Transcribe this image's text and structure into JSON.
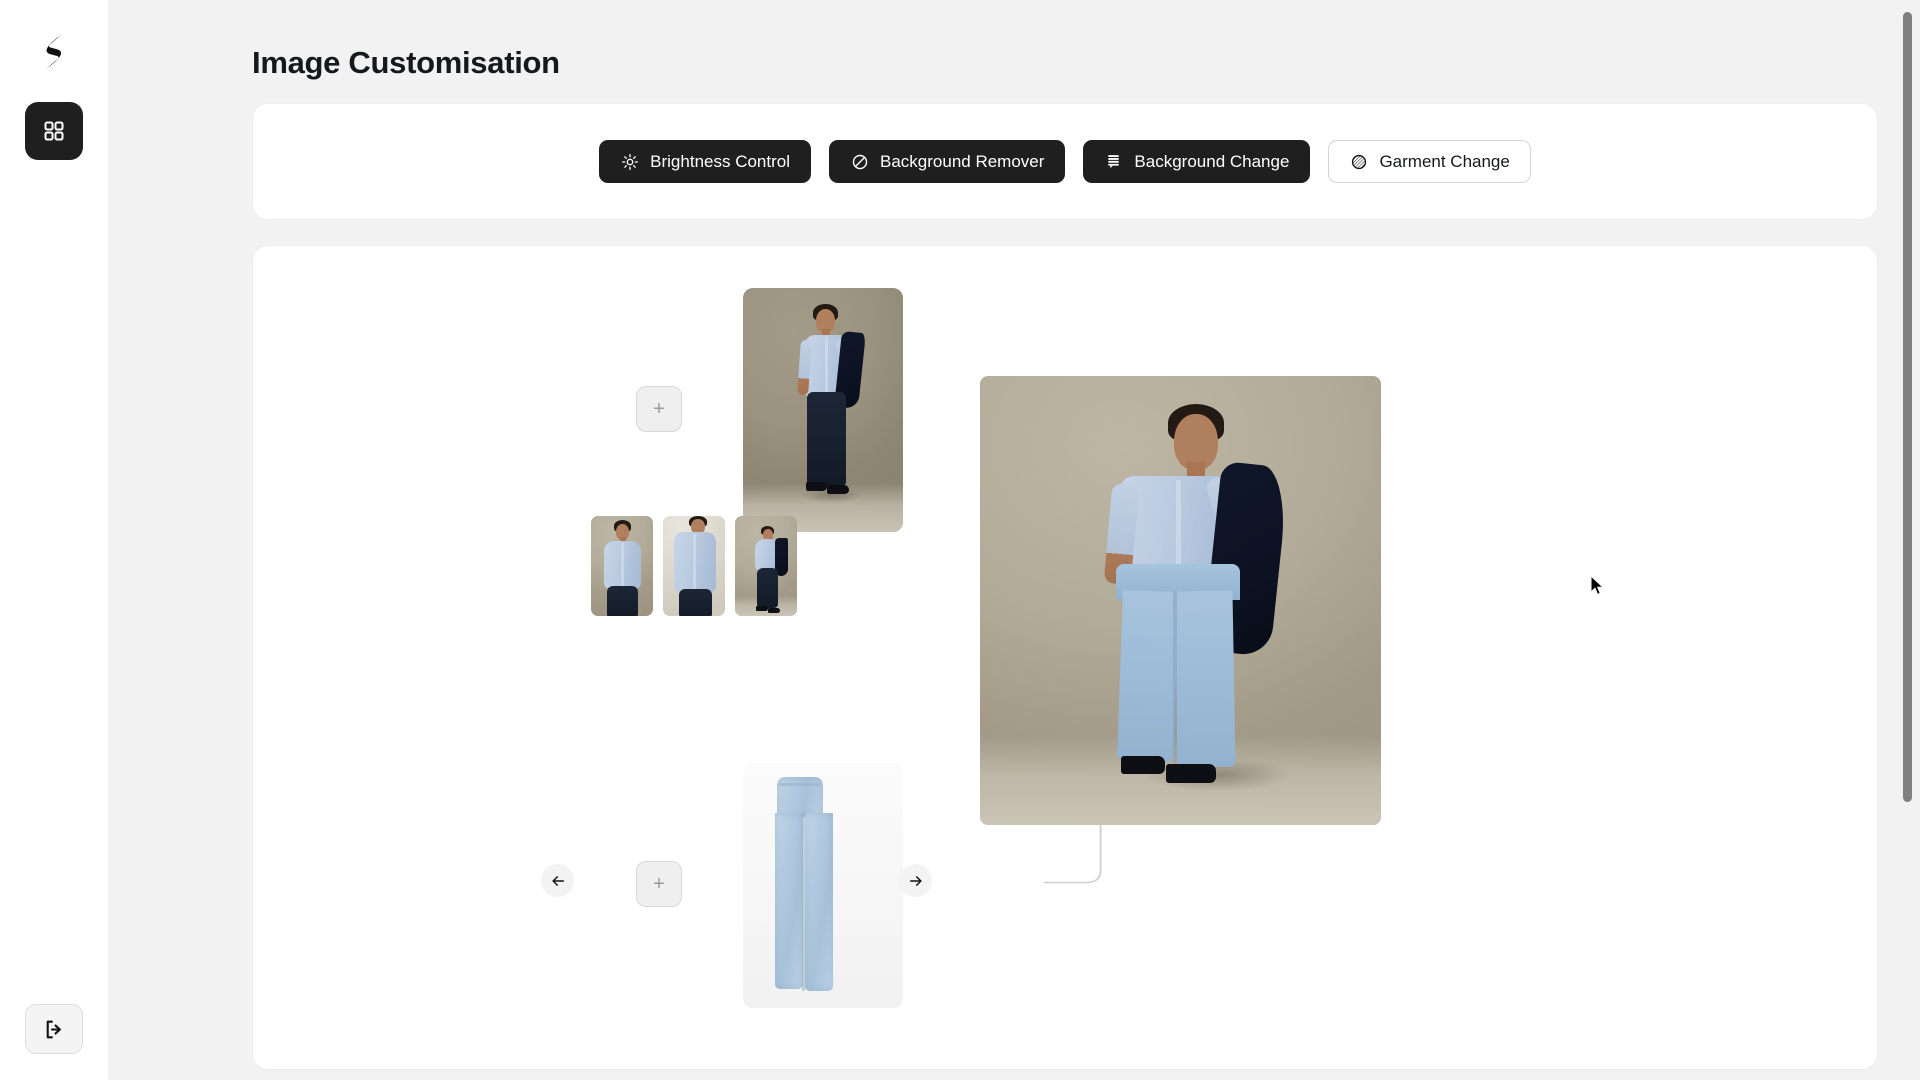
{
  "app": {
    "logo_icon": "brand-s-logo",
    "nav": [
      {
        "id": "dashboard",
        "icon": "grid-icon",
        "active": true
      }
    ],
    "logout": {
      "icon": "logout-icon",
      "label": "Logout"
    }
  },
  "header": {
    "title": "Image Customisation"
  },
  "toolbar": {
    "buttons": [
      {
        "id": "brightness-control",
        "label": "Brightness Control",
        "icon": "sun-icon",
        "style": "dark",
        "active": false
      },
      {
        "id": "background-remover",
        "label": "Background Remover",
        "icon": "no-entry-icon",
        "style": "dark",
        "active": false
      },
      {
        "id": "background-change",
        "label": "Background Change",
        "icon": "layers-icon",
        "style": "dark",
        "active": false
      },
      {
        "id": "garment-change",
        "label": "Garment Change",
        "icon": "texture-circle-icon",
        "style": "light",
        "active": true
      }
    ]
  },
  "canvas": {
    "nodes": {
      "top_add": {
        "label": "+",
        "name": "add-source-image-top"
      },
      "bottom_add": {
        "label": "+",
        "name": "add-source-image-bottom"
      },
      "model_image": {
        "alt": "Model in light blue shirt and navy trousers holding navy jacket"
      },
      "garment_image": {
        "alt": "Light wash wide leg jeans on white background"
      },
      "result_image": {
        "alt": "Generated result: model wearing light blue shirt with light wash jeans"
      }
    },
    "carousel": {
      "prev_label": "←",
      "next_label": "→",
      "thumbnails": [
        {
          "id": "thumb-1",
          "alt": "Model front view light blue shirt",
          "selected": false
        },
        {
          "id": "thumb-2",
          "alt": "Model torso close up light blue shirt",
          "selected": false
        },
        {
          "id": "thumb-3",
          "alt": "Model full body with jacket over shoulder",
          "selected": false
        }
      ]
    }
  },
  "colors": {
    "page_bg": "#f2f2f2",
    "panel_bg": "#ffffff",
    "accent_dark": "#1f1f1f",
    "text_primary": "#16181d",
    "muted": "#9a9a9a",
    "link_line": "#cfcfcf",
    "scrollbar": "#808080"
  },
  "scroll": {
    "thumb_position_pct": 0
  }
}
